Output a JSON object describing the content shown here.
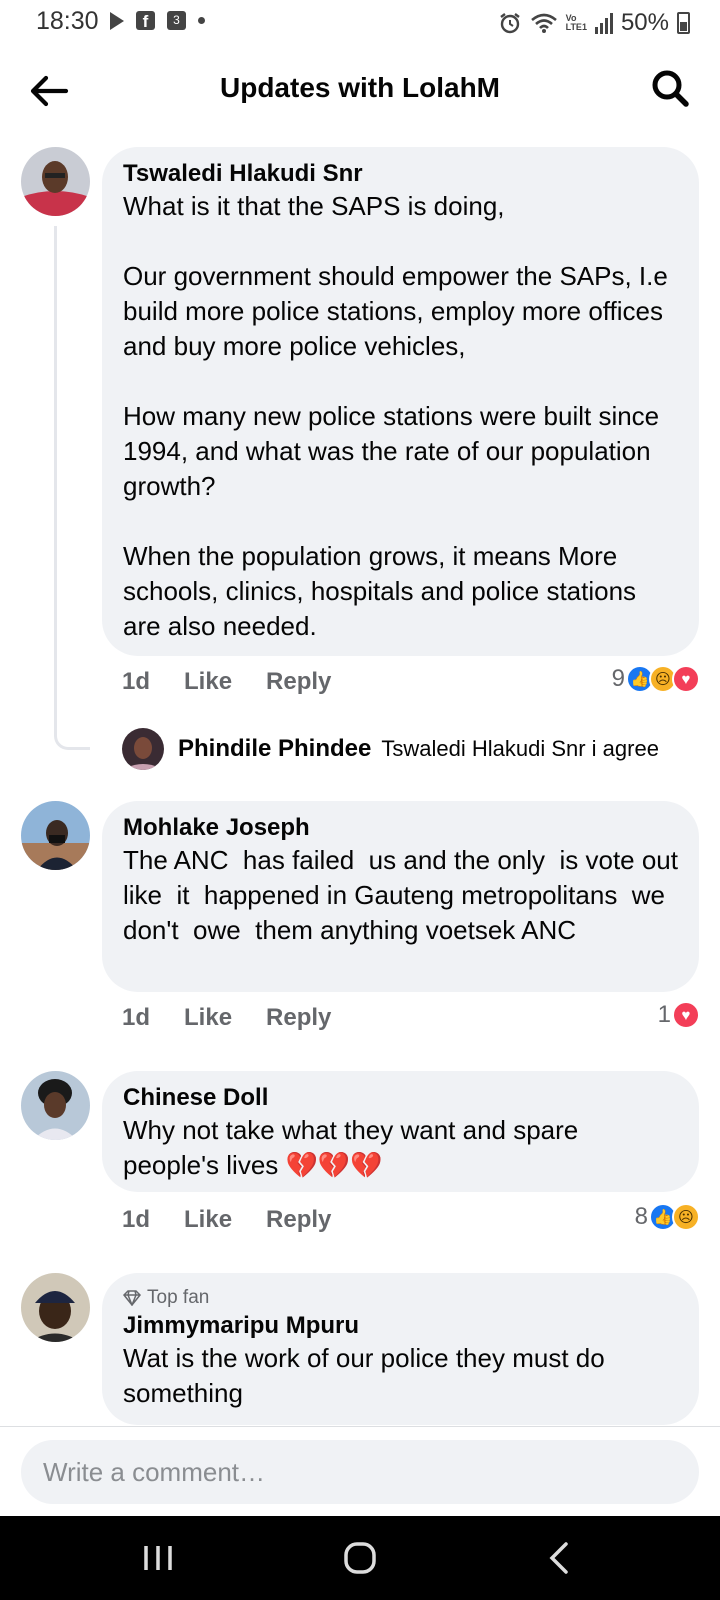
{
  "status_bar": {
    "time": "18:30",
    "battery": "50%",
    "lte_top": "Vo",
    "lte_bottom": "LTE1",
    "icons": [
      "play-icon",
      "facebook-icon",
      "notification-3-icon",
      "dot-icon",
      "alarm-icon",
      "wifi-icon",
      "signal-icon",
      "battery-icon"
    ]
  },
  "header": {
    "title": "Updates with LolahM",
    "back_icon": "back-arrow-icon",
    "search_icon": "search-icon"
  },
  "comments": [
    {
      "author": "Tswaledi Hlakudi Snr",
      "text": "What is it that the SAPS is doing,\n\nOur government should empower the SAPs, I.e build more police stations, employ more offices and buy more police vehicles,\n\nHow many new police stations were built since 1994, and what was the rate of our population growth?\n\nWhen the population grows, it means More schools, clinics, hospitals and police stations are also needed.",
      "time": "1d",
      "like": "Like",
      "reply": "Reply",
      "reaction_count": "9",
      "reactions": [
        "like",
        "sad",
        "love"
      ]
    },
    {
      "author": "Mohlake Joseph",
      "text": "The ANC  has failed  us and the only  is vote out  like  it  happened in Gauteng metropolitans  we don't  owe  them anything voetsek ANC",
      "time": "1d",
      "like": "Like",
      "reply": "Reply",
      "reaction_count": "1",
      "reactions": [
        "love"
      ]
    },
    {
      "author": "Chinese Doll",
      "text": "Why not take what they want and spare people's lives 💔💔💔",
      "time": "1d",
      "like": "Like",
      "reply": "Reply",
      "reaction_count": "8",
      "reactions": [
        "like",
        "sad"
      ]
    },
    {
      "badge": "Top fan",
      "author": "Jimmymaripu Mpuru",
      "text": "Wat is the work of our police they must do something"
    }
  ],
  "reply_preview": {
    "author": "Phindile Phindee",
    "text": "Tswaledi Hlakudi Snr i agree"
  },
  "composer": {
    "placeholder": "Write a comment…"
  },
  "colors": {
    "bubble": "#f0f2f5",
    "like_blue": "#1877f2",
    "love_red": "#f33e58",
    "sad_yellow": "#f7b125",
    "meta_gray": "#65676b"
  }
}
